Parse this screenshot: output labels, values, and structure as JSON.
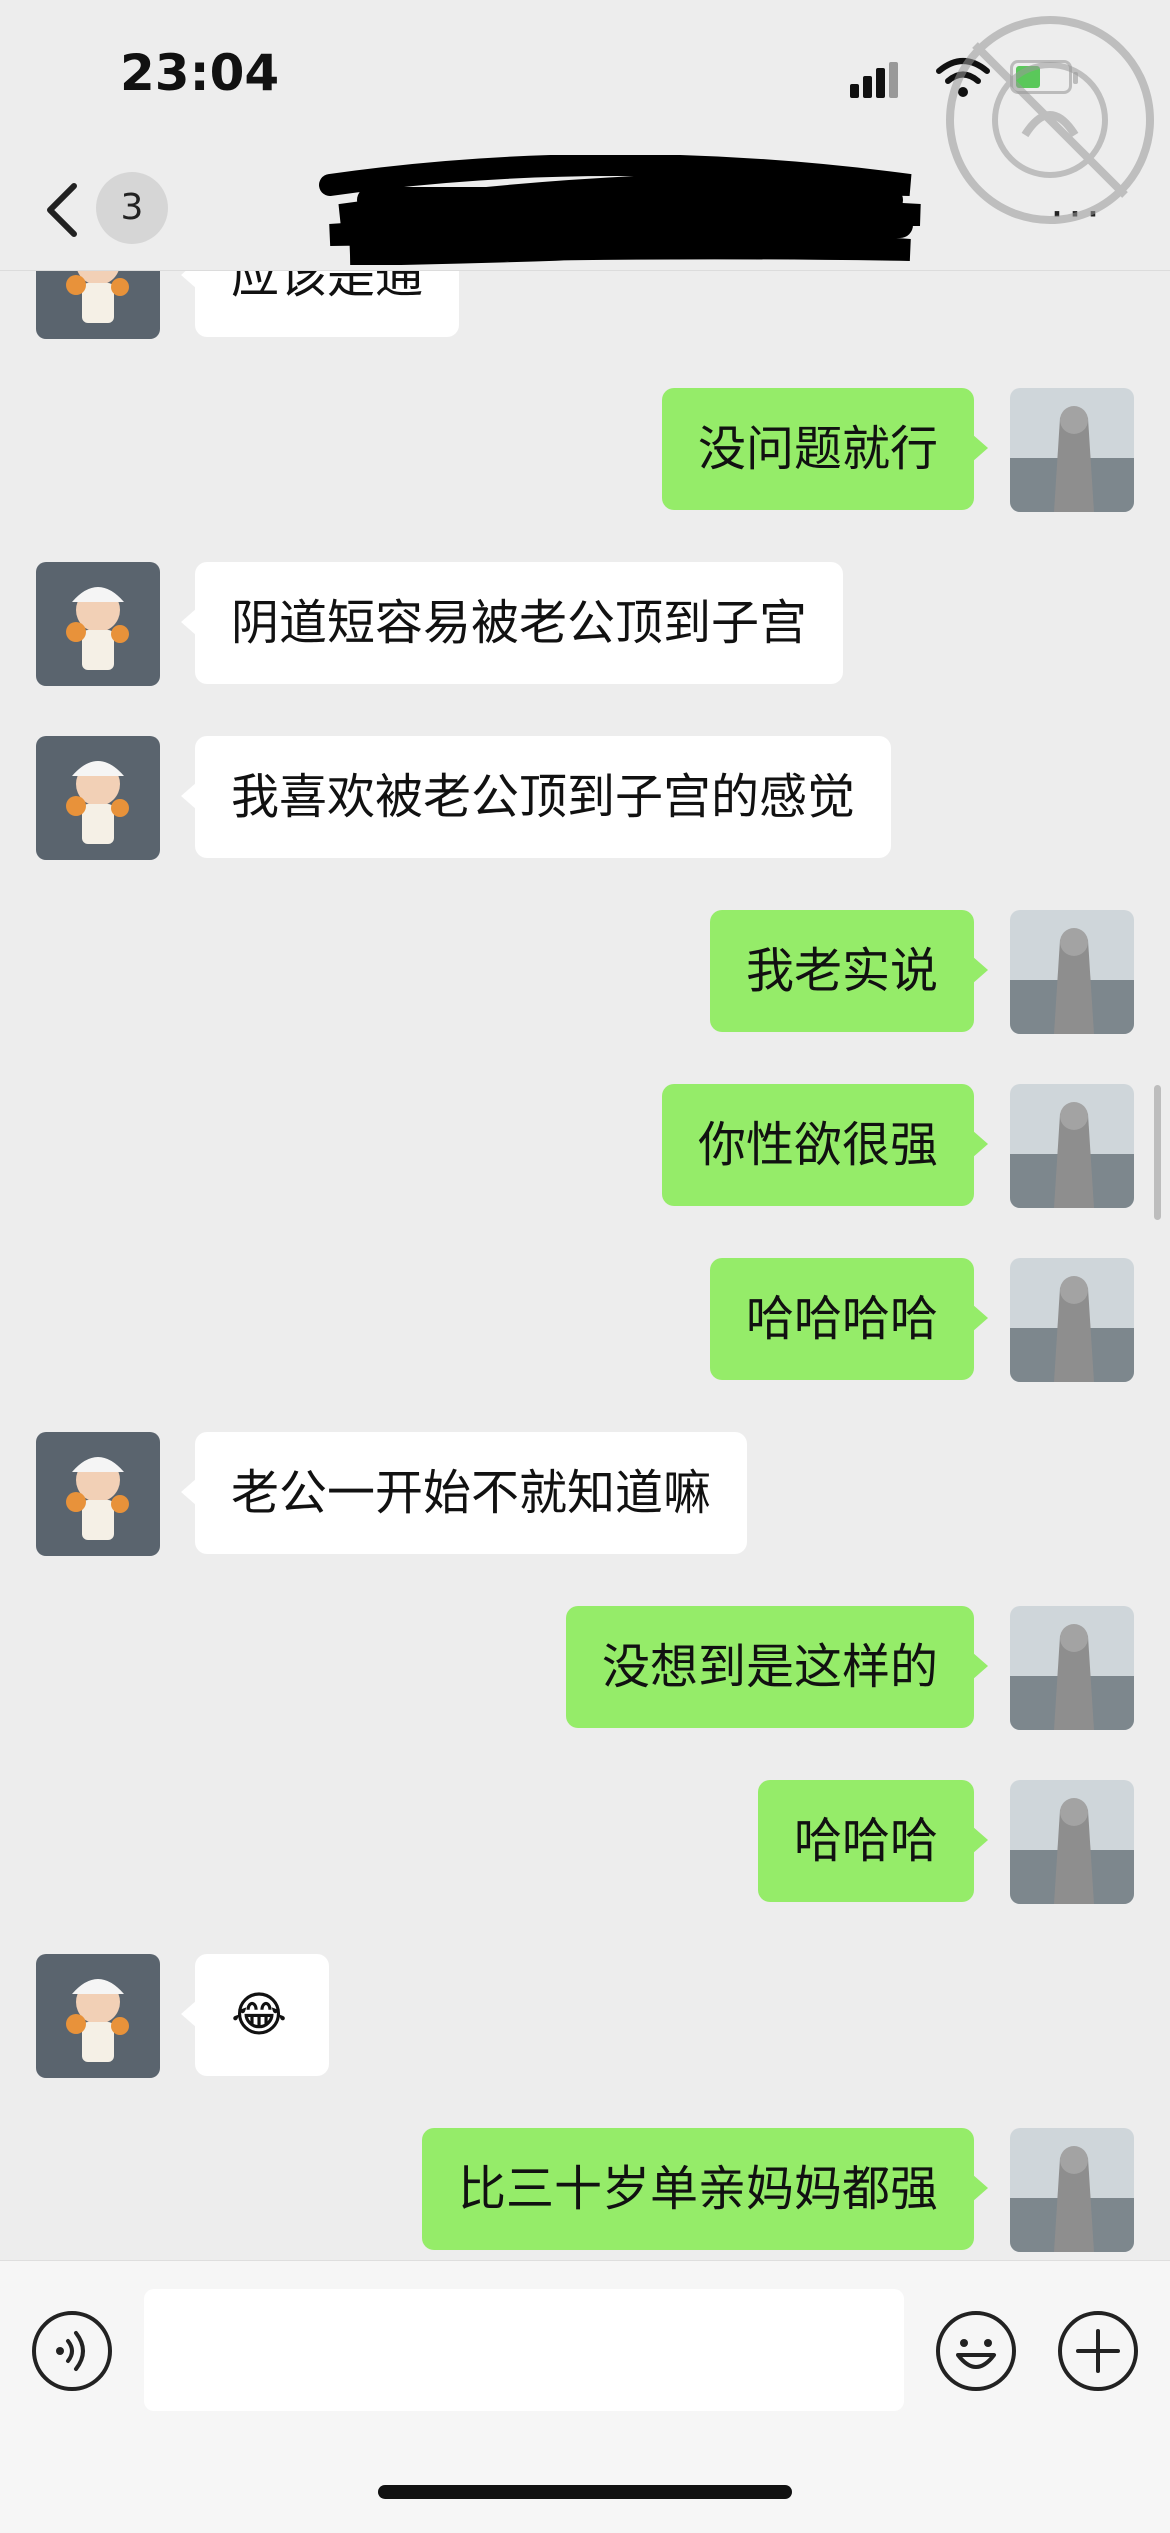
{
  "status_bar": {
    "time": "23:04"
  },
  "nav": {
    "unread_count": "3",
    "more_label": "···"
  },
  "messages": [
    {
      "side": "left",
      "text": "应该是通"
    },
    {
      "side": "right",
      "text": "没问题就行"
    },
    {
      "side": "left",
      "text": "阴道短容易被老公顶到子宫"
    },
    {
      "side": "left",
      "text": "我喜欢被老公顶到子宫的感觉"
    },
    {
      "side": "right",
      "text": "我老实说"
    },
    {
      "side": "right",
      "text": "你性欲很强"
    },
    {
      "side": "right",
      "text": "哈哈哈哈"
    },
    {
      "side": "left",
      "text": "老公一开始不就知道嘛"
    },
    {
      "side": "right",
      "text": "没想到是这样的"
    },
    {
      "side": "right",
      "text": "哈哈哈"
    },
    {
      "side": "left",
      "text": "😂"
    },
    {
      "side": "right",
      "text": "比三十岁单亲妈妈都强"
    }
  ],
  "input": {
    "value": ""
  },
  "colors": {
    "background": "#ededed",
    "sent_bubble": "#95ec69",
    "received_bubble": "#ffffff"
  },
  "icons": [
    "back-chevron-icon",
    "signal-icon",
    "wifi-icon",
    "battery-icon",
    "more-icon",
    "voice-icon",
    "emoji-icon",
    "plus-icon"
  ]
}
